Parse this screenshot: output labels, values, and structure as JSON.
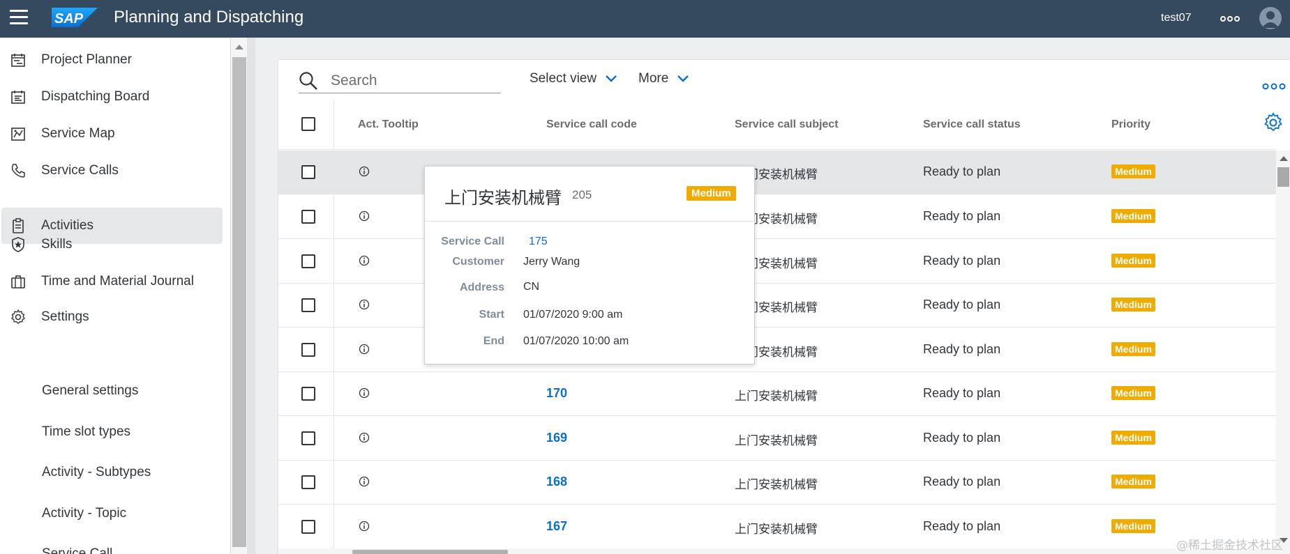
{
  "shell": {
    "title": "Planning and Dispatching",
    "logo_text": "SAP",
    "username": "test07",
    "brand_color": "#354a5f",
    "logo_color": "#0a6ed1"
  },
  "sidebar": {
    "items": [
      {
        "label": "Project Planner",
        "icon": "calendar-plan-icon"
      },
      {
        "label": "Dispatching Board",
        "icon": "calendar-board-icon"
      },
      {
        "label": "Service Map",
        "icon": "map-icon"
      },
      {
        "label": "Service Calls",
        "icon": "phone-icon"
      },
      {
        "label": "Activities",
        "icon": "clipboard-icon",
        "selected": true
      },
      {
        "label": "Skills",
        "icon": "badge-star-icon"
      },
      {
        "label": "Time and Material Journal",
        "icon": "briefcase-icon"
      },
      {
        "label": "Settings",
        "icon": "gear-icon"
      }
    ],
    "subitems": [
      "General settings",
      "Time slot types",
      "Activity - Subtypes",
      "Activity - Topic",
      "Service Call"
    ]
  },
  "toolbar": {
    "search_placeholder": "Search",
    "select_view_label": "Select view",
    "more_label": "More"
  },
  "table": {
    "headers": [
      "Act. Tooltip",
      "Service call code",
      "Service call subject",
      "Service call status",
      "Priority"
    ],
    "rows": [
      {
        "code": "",
        "subject": "上门安装机械臂",
        "status": "Ready to plan",
        "priority": "Medium"
      },
      {
        "code": "",
        "subject": "上门安装机械臂",
        "status": "Ready to plan",
        "priority": "Medium"
      },
      {
        "code": "",
        "subject": "上门安装机械臂",
        "status": "Ready to plan",
        "priority": "Medium"
      },
      {
        "code": "",
        "subject": "上门安装机械臂",
        "status": "Ready to plan",
        "priority": "Medium"
      },
      {
        "code": "",
        "subject": "上门安装机械臂",
        "status": "Ready to plan",
        "priority": "Medium"
      },
      {
        "code": "170",
        "subject": "上门安装机械臂",
        "status": "Ready to plan",
        "priority": "Medium"
      },
      {
        "code": "169",
        "subject": "上门安装机械臂",
        "status": "Ready to plan",
        "priority": "Medium"
      },
      {
        "code": "168",
        "subject": "上门安装机械臂",
        "status": "Ready to plan",
        "priority": "Medium"
      },
      {
        "code": "167",
        "subject": "上门安装机械臂",
        "status": "Ready to plan",
        "priority": "Medium"
      }
    ],
    "priority_color": "#f0ab00",
    "link_color": "#0a6ed1"
  },
  "tooltip": {
    "title": "上门安装机械臂",
    "id": "205",
    "priority": "Medium",
    "fields": [
      {
        "label": "Service Call",
        "value": "175",
        "link": true
      },
      {
        "label": "Customer",
        "value": "Jerry Wang"
      },
      {
        "label": "Address",
        "value": "CN"
      },
      {
        "label": "Start",
        "value": "01/07/2020 9:00 am"
      },
      {
        "label": "End",
        "value": "01/07/2020 10:00 am"
      }
    ]
  },
  "watermark": "@稀土掘金技术社区"
}
